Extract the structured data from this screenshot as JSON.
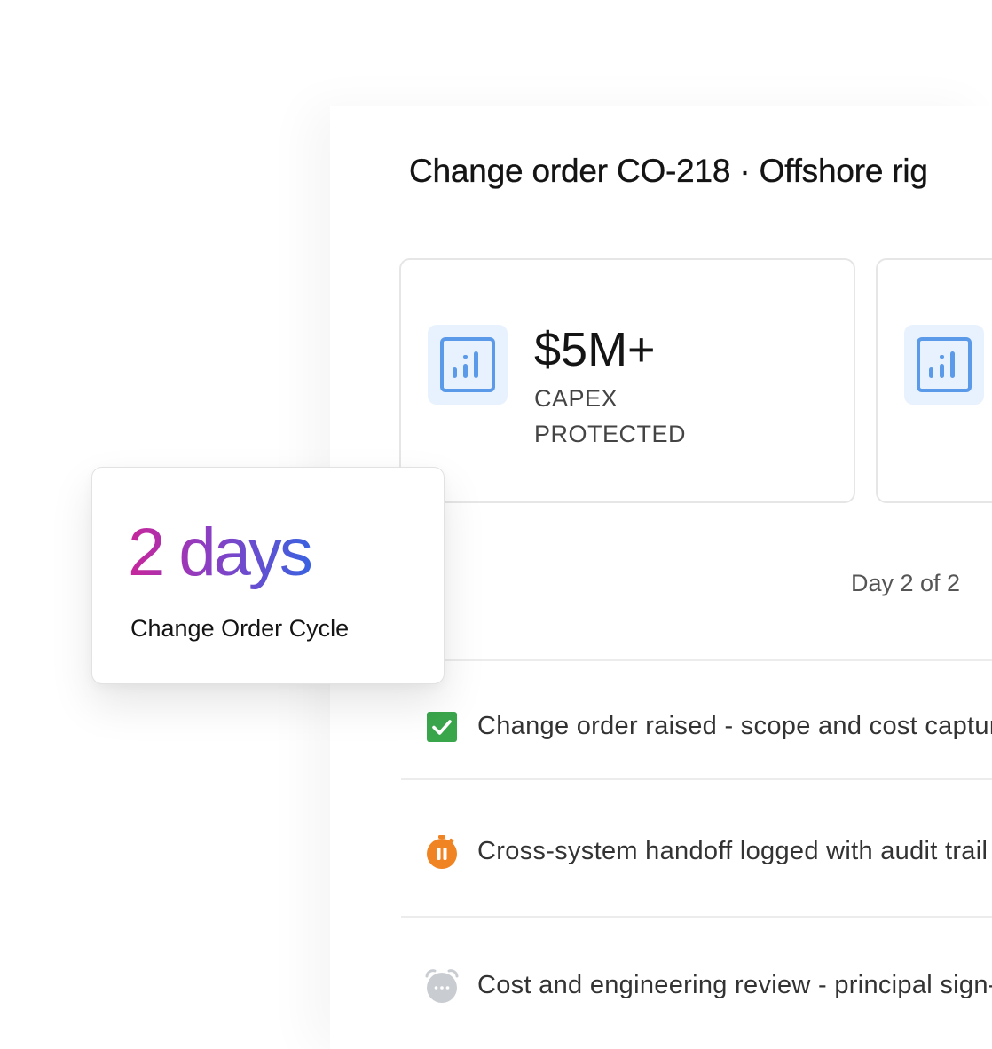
{
  "header": {
    "title": "Change order CO-218 · Offshore rig"
  },
  "stats": [
    {
      "value": "$5M+",
      "label": "CAPEX PROTECTED",
      "icon": "bar-chart-icon"
    },
    {
      "value": "",
      "label": "",
      "icon": "bar-chart-icon"
    }
  ],
  "progress": {
    "day_text": "Day 2 of 2"
  },
  "steps": [
    {
      "text": "Change order raised - scope and cost captured",
      "status": "complete",
      "icon": "check-icon"
    },
    {
      "text": "Cross-system handoff logged with audit trail",
      "status": "paused",
      "icon": "stopwatch-pause-icon"
    },
    {
      "text": "Cost and engineering review - principal sign-off",
      "status": "pending",
      "icon": "alarm-pending-icon"
    }
  ],
  "cycle_card": {
    "value": "2 days",
    "label": "Change Order Cycle"
  },
  "colors": {
    "icon_blue": "#5b9ae8",
    "icon_bg": "#e8f1fe",
    "complete_green": "#3aa64c",
    "paused_orange": "#f08322",
    "pending_gray": "#c9cdd2",
    "gradient_start": "#c8269a",
    "gradient_end": "#3a62e0"
  }
}
